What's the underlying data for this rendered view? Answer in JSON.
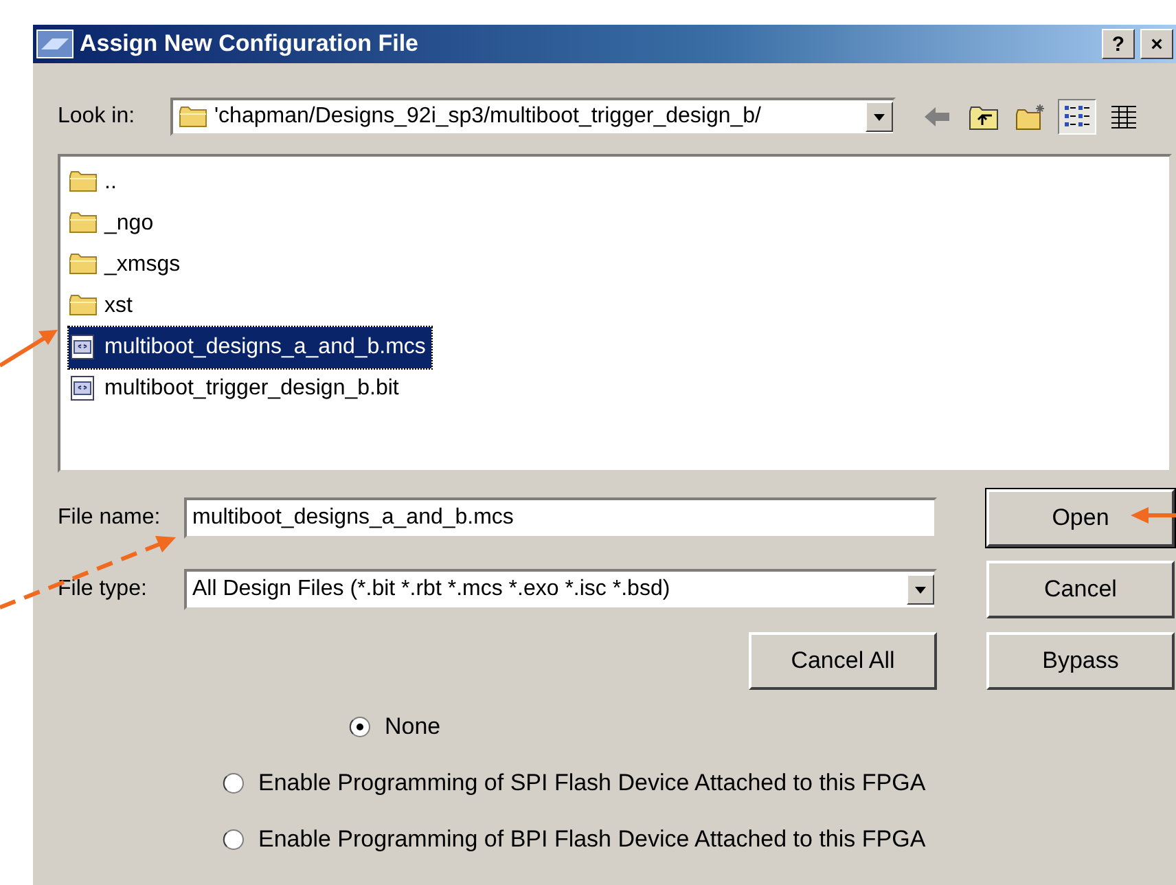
{
  "window": {
    "title": "Assign New Configuration File",
    "buttons": [
      "?",
      "×"
    ]
  },
  "look_in": {
    "label": "Look in:",
    "value": "'chapman/Designs_92i_sp3/multiboot_trigger_design_b/"
  },
  "view_buttons": [
    {
      "selected": true
    },
    {
      "selected": false
    }
  ],
  "files": [
    {
      "name": "..",
      "kind": "folder",
      "selected": false
    },
    {
      "name": "_ngo",
      "kind": "folder",
      "selected": false
    },
    {
      "name": "_xmsgs",
      "kind": "folder",
      "selected": false
    },
    {
      "name": "xst",
      "kind": "folder",
      "selected": false
    },
    {
      "name": "multiboot_designs_a_and_b.mcs",
      "kind": "file",
      "selected": true
    },
    {
      "name": "multiboot_trigger_design_b.bit",
      "kind": "file",
      "selected": false
    }
  ],
  "file_name": {
    "label": "File name:",
    "value": "multiboot_designs_a_and_b.mcs"
  },
  "file_type": {
    "label": "File type:",
    "value": "All Design Files (*.bit *.rbt *.mcs *.exo *.isc *.bsd)"
  },
  "buttons": [
    {
      "label": "Open",
      "default": true
    },
    {
      "label": "Cancel",
      "default": false
    },
    {
      "label": "Cancel All",
      "default": false
    },
    {
      "label": "Bypass",
      "default": false
    }
  ],
  "options": [
    {
      "label": "None",
      "selected": true
    },
    {
      "label": "Enable Programming of SPI Flash Device Attached to this FPGA",
      "selected": false
    },
    {
      "label": "Enable Programming of BPI Flash Device Attached to this FPGA",
      "selected": false
    }
  ]
}
